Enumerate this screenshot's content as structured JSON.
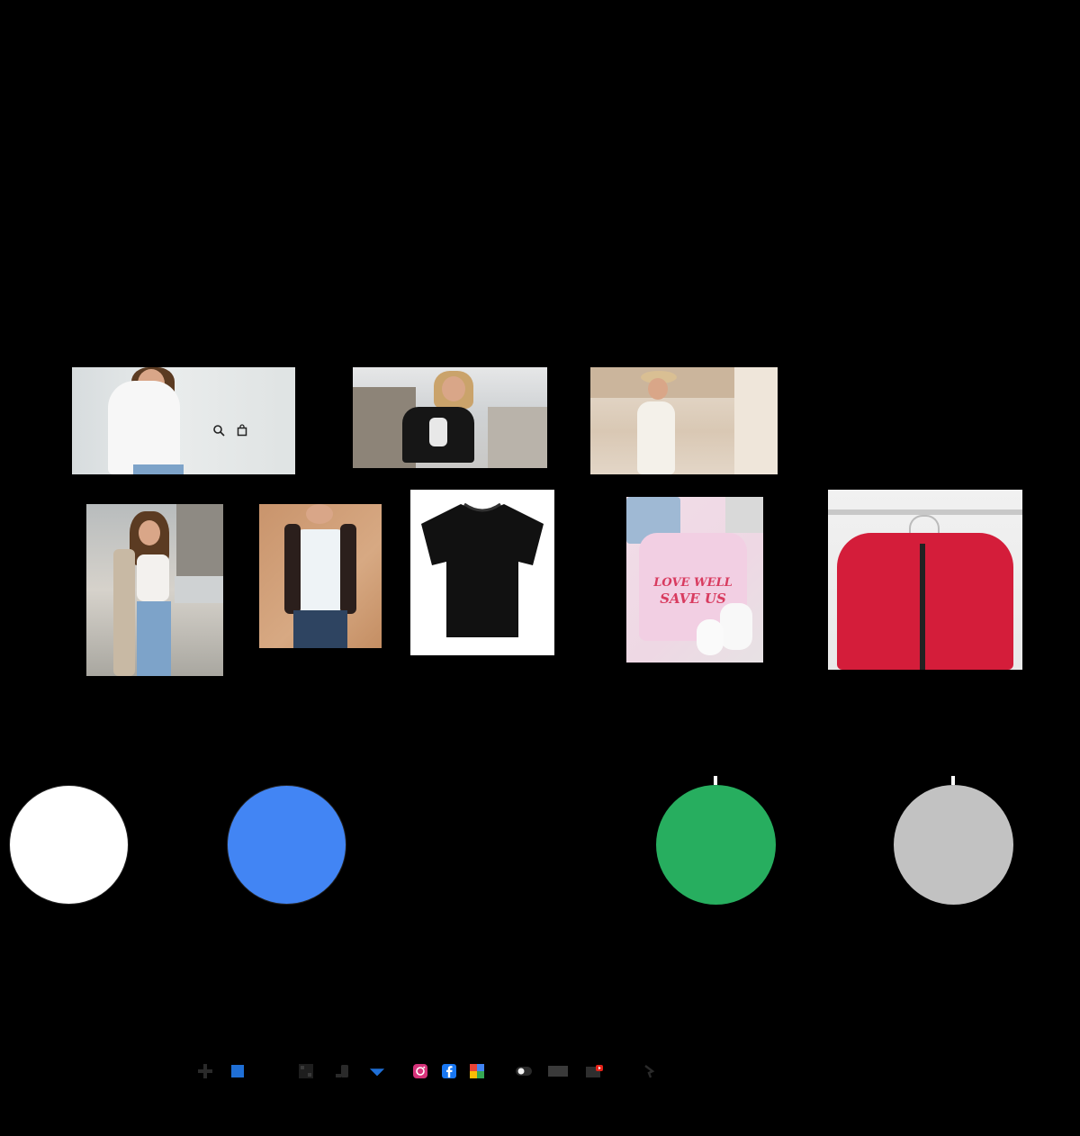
{
  "photos": [
    {
      "name": "woman-white-tee",
      "overlay_icons": [
        "search-icon",
        "bag-icon"
      ]
    },
    {
      "name": "woman-black-crop-tee"
    },
    {
      "name": "woman-white-dress-beach"
    },
    {
      "name": "woman-street-jeans"
    },
    {
      "name": "man-white-tee"
    },
    {
      "name": "black-tshirt"
    },
    {
      "name": "pink-tshirt-flatlay",
      "tshirt_text_line1": "LOVE WELL",
      "tshirt_text_line2": "SAVE US"
    },
    {
      "name": "red-puffer-jacket"
    }
  ],
  "colors": {
    "background": "#000000",
    "swatch_white": "#ffffff",
    "swatch_blue": "#4285f4",
    "swatch_green": "#27ae5f",
    "swatch_gray": "#c2c2c2"
  },
  "icon_strip": [
    "plus-icon",
    "blue-square-icon",
    "qr-icon",
    "phone-icon",
    "dropdown-icon",
    "instagram-icon",
    "facebook-icon",
    "google-icon",
    "toggle-icon",
    "card-icon",
    "youtube-icon",
    "share-icon"
  ]
}
